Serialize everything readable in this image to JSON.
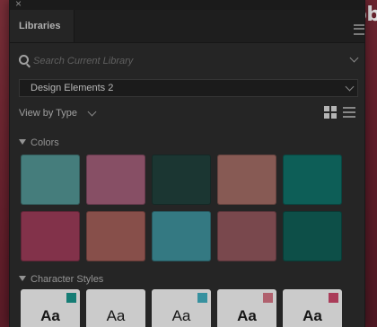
{
  "brand": {
    "text": "Adobe"
  },
  "panel": {
    "close_glyph": "×",
    "tab_label": "Libraries",
    "menu_icon": "hamburger-menu-icon"
  },
  "search": {
    "placeholder": "Search Current Library",
    "value": ""
  },
  "library_select": {
    "selected": "Design Elements 2"
  },
  "view": {
    "label": "View by Type",
    "modes": [
      "grid-view-icon",
      "list-view-icon"
    ],
    "active_mode": "grid"
  },
  "colors_section": {
    "title": "Colors",
    "swatches": [
      "#4f8f8e",
      "#9a5a74",
      "#1f3e3a",
      "#9a6760",
      "#0f6b63",
      "#953a55",
      "#9a5a55",
      "#3c8a94",
      "#8a5258",
      "#0f5a52"
    ]
  },
  "char_section": {
    "title": "Character Styles",
    "items": [
      {
        "sample": "Aa",
        "chip": "#1a8f86",
        "weight": "bold"
      },
      {
        "sample": "Aa",
        "chip": "",
        "weight": "normal"
      },
      {
        "sample": "Aa",
        "chip": "#3fa5b5",
        "weight": "normal"
      },
      {
        "sample": "Aa",
        "chip": "#c96f7e",
        "weight": "bold"
      },
      {
        "sample": "Aa",
        "chip": "#c24566",
        "weight": "bold"
      }
    ]
  }
}
